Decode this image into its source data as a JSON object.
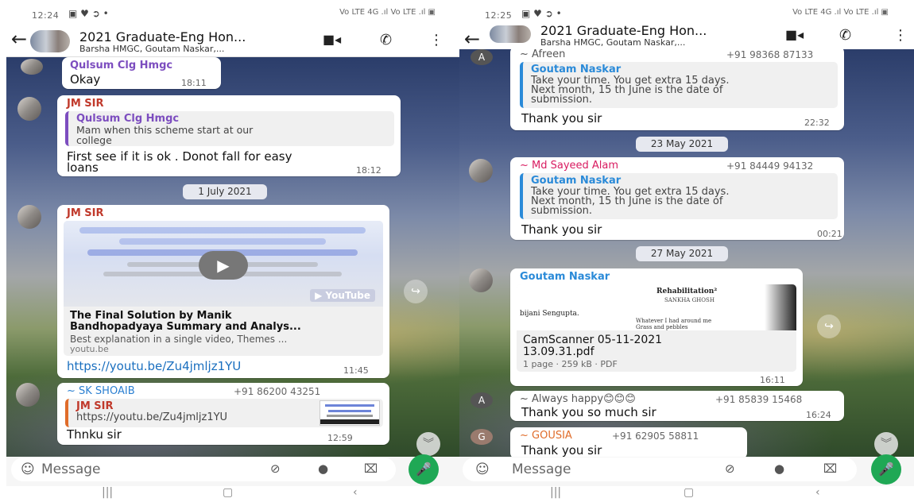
{
  "left": {
    "status": {
      "time": "12:24",
      "icons": "▣ ♥ ➲ •",
      "signal": "Vo LTE 4G .ıl Vo LTE .ıl ▣"
    },
    "header": {
      "title": "2021 Graduate-Eng Hon...",
      "subtitle": "Barsha HMGC, Goutam Naskar,..."
    },
    "msg1": {
      "sender": "Qulsum Clg Hmgc",
      "text": "Okay",
      "time": "18:11"
    },
    "msg2": {
      "sender": "JM SIR",
      "quote_name": "Qulsum Clg Hmgc",
      "quote_text1": "Mam when this scheme start at our",
      "quote_text2": "college",
      "text1": "First see if it is ok . Donot fall for easy",
      "text2": "loans",
      "time": "18:12"
    },
    "date1": "1 July 2021",
    "msg3": {
      "sender": "JM SIR",
      "preview_title1": "The Final Solution by Manik",
      "preview_title2": "Bandhopadyaya Summary and Analys...",
      "preview_desc": "Best explanation in a single video, Themes ...",
      "preview_domain": "youtu.be",
      "yt_label": "YouTube",
      "link": "https://youtu.be/Zu4jmljz1YU",
      "time": "11:45"
    },
    "msg4": {
      "sender": "~ SK SHOAIB",
      "phone": "+91 86200 43251",
      "quote_name": "JM SIR",
      "quote_text": "https://youtu.be/Zu4jmljz1YU",
      "text": "Thnku sir",
      "time": "12:59"
    },
    "input": {
      "placeholder": "Message"
    }
  },
  "right": {
    "status": {
      "time": "12:25",
      "icons": "▣ ♥ ➲ •",
      "signal": "Vo LTE 4G .ıl Vo LTE .ıl ▣"
    },
    "header": {
      "title": "2021 Graduate-Eng Hon...",
      "subtitle": "Barsha HMGC, Goutam Naskar,..."
    },
    "msg1": {
      "sender": "~ Afreen",
      "phone": "+91 98368 87133",
      "quote_name": "Goutam Naskar",
      "qt1": "Take your time. You get extra 15 days.",
      "qt2": "Next month, 15 th June is the date of",
      "qt3": "submission.",
      "text": "Thank you sir",
      "time": "22:32",
      "avatar": "A"
    },
    "date1": "23 May 2021",
    "msg2": {
      "sender": "~ Md Sayeed Alam",
      "phone": "+91 84449 94132",
      "quote_name": "Goutam Naskar",
      "qt1": "Take your time. You get extra 15 days.",
      "qt2": "Next month, 15 th June is the date of",
      "qt3": "submission.",
      "text": "Thank you sir",
      "time": "00:21"
    },
    "date2": "27 May 2021",
    "msg3": {
      "sender": "Goutam Naskar",
      "doc_line1": "Rehabilitation²",
      "doc_line2": "SANKHA GHOSH",
      "doc_line3": "bijani Sengupta.",
      "doc_line4": "Whatever I had around me",
      "doc_line5": "Grass and pebbles",
      "file1": "CamScanner 05-11-2021",
      "file2": "13.09.31.pdf",
      "meta": "1 page · 259 kB · PDF",
      "time": "16:11"
    },
    "msg4": {
      "sender": "~ Always happy😊😊😊",
      "phone": "+91 85839 15468",
      "text": "Thank you so much sir",
      "time": "16:24",
      "avatar": "A"
    },
    "msg5": {
      "sender": "~ GOUSIA",
      "phone": "+91 62905 58811",
      "text": "Thank you  sir",
      "avatar": "G"
    },
    "input": {
      "placeholder": "Message"
    }
  },
  "colors": {
    "green": "#1fa855",
    "purple": "#7c4dbf",
    "blue": "#1a6fbf",
    "red": "#c0392b",
    "pink": "#d81b60",
    "orange": "#e06c2a"
  }
}
